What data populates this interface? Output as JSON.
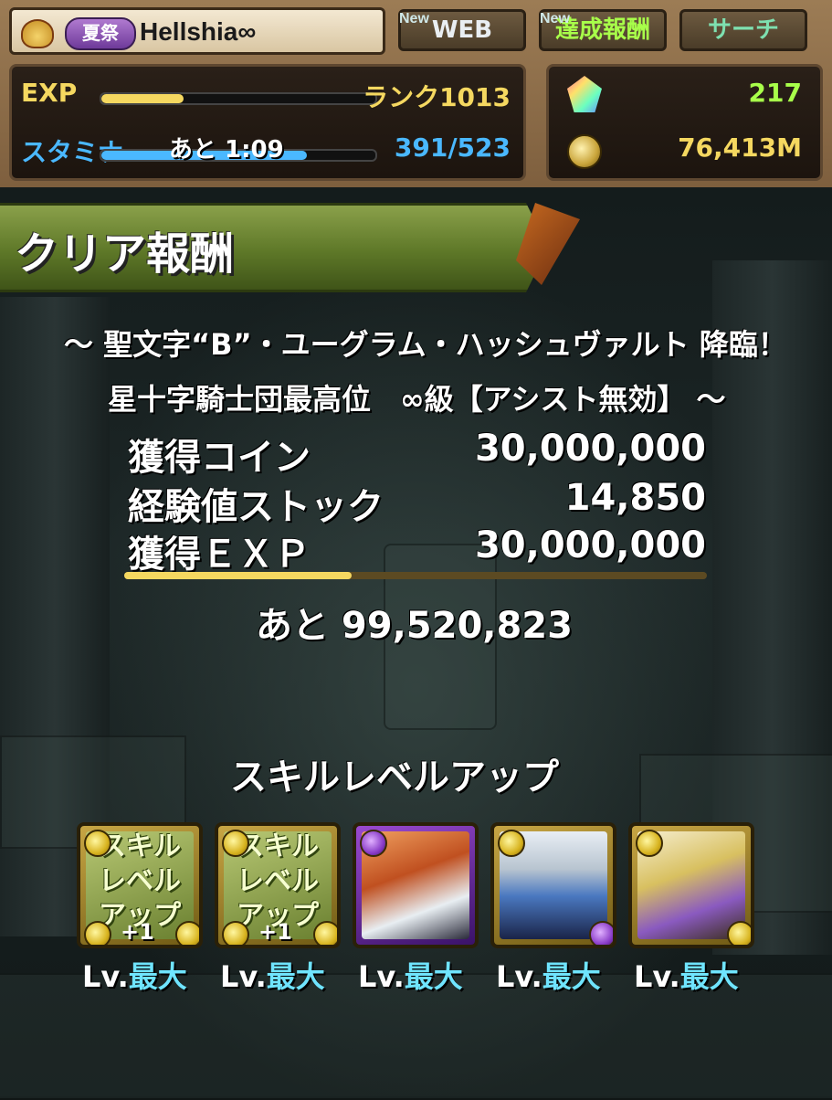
{
  "header": {
    "festival_badge": "夏祭",
    "player_name": "Hellshia∞",
    "tabs": [
      {
        "label": "WEB",
        "new": "New"
      },
      {
        "label": "達成報酬",
        "new": "New"
      },
      {
        "label": "サーチ"
      }
    ],
    "exp_label": "EXP",
    "exp_progress": 0.3,
    "rank": "ランク1013",
    "stamina_label": "スタミナ",
    "stamina_timer": "あと 1:09",
    "stamina_progress": 0.75,
    "stamina": "391/523",
    "magic_stones": "217",
    "coins": "76,413M"
  },
  "banner": {
    "title": "クリア報酬"
  },
  "dungeon": {
    "line1": "～ 聖文字“B”・ユーグラム・ハッシュヴァルト 降臨！",
    "line2": "星十字騎士団最高位　∞級【アシスト無効】 ～"
  },
  "rewards": [
    {
      "label": "獲得コイン",
      "value": "30,000,000"
    },
    {
      "label": "経験値ストック",
      "value": "14,850"
    },
    {
      "label": "獲得ＥＸＰ",
      "value": "30,000,000"
    }
  ],
  "rank_progress": 0.39,
  "remaining": "あと 99,520,823",
  "skill_section": {
    "title": "スキルレベルアップ",
    "cards": [
      {
        "text": "スキルレベルアップ",
        "plus": "+1",
        "lv_prefix": "Lv.",
        "lv": "最大"
      },
      {
        "text": "スキルレベルアップ",
        "plus": "+1",
        "lv_prefix": "Lv.",
        "lv": "最大"
      },
      {
        "lv_prefix": "Lv.",
        "lv": "最大"
      },
      {
        "lv_prefix": "Lv.",
        "lv": "最大"
      },
      {
        "lv_prefix": "Lv.",
        "lv": "最大"
      }
    ]
  },
  "colors": {
    "accent_green": "#a8ff4a",
    "stamina_blue": "#4ab8ff",
    "rank_yellow": "#f5d860",
    "lv_max": "#6fe4ff"
  }
}
